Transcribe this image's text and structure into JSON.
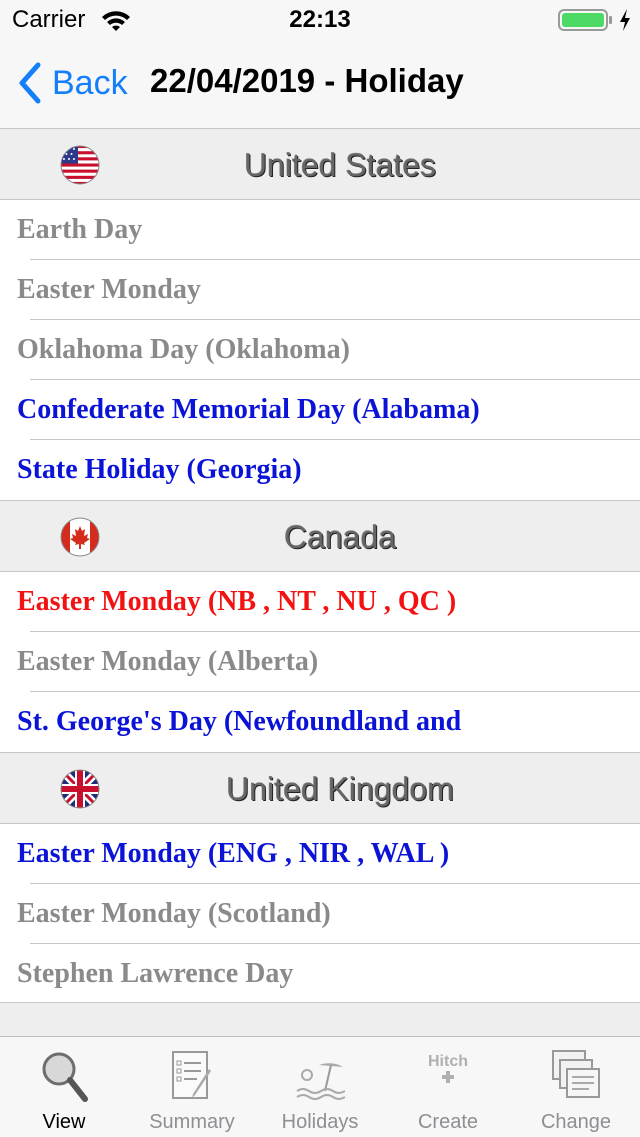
{
  "status": {
    "carrier": "Carrier",
    "time": "22:13"
  },
  "nav": {
    "back_label": "Back",
    "title": "22/04/2019 - Holiday"
  },
  "colors": {
    "gray": "#8a8a8a",
    "blue": "#0b14d6",
    "red": "#f21212",
    "ios_blue": "#147efb"
  },
  "sections": [
    {
      "title": "United States",
      "flag": "us-flag-icon",
      "rows": [
        {
          "text": "Earth Day",
          "color": "gray"
        },
        {
          "text": "Easter Monday",
          "color": "gray"
        },
        {
          "text": "Oklahoma Day (Oklahoma)",
          "color": "gray"
        },
        {
          "text": "Confederate Memorial Day (Alabama)",
          "color": "blue"
        },
        {
          "text": "State Holiday (Georgia)",
          "color": "blue"
        }
      ]
    },
    {
      "title": "Canada",
      "flag": "canada-flag-icon",
      "rows": [
        {
          "text": "Easter Monday (NB , NT , NU , QC )",
          "color": "red"
        },
        {
          "text": "Easter Monday (Alberta)",
          "color": "gray"
        },
        {
          "text": "St. George's Day (Newfoundland and",
          "color": "blue"
        }
      ]
    },
    {
      "title": "United Kingdom",
      "flag": "uk-flag-icon",
      "rows": [
        {
          "text": "Easter Monday (ENG , NIR , WAL )",
          "color": "blue"
        },
        {
          "text": "Easter Monday (Scotland)",
          "color": "gray"
        },
        {
          "text": "Stephen Lawrence Day",
          "color": "gray"
        }
      ]
    }
  ],
  "tabs": [
    {
      "label": "View",
      "icon": "magnifier-icon",
      "active": true
    },
    {
      "label": "Summary",
      "icon": "checklist-icon",
      "active": false
    },
    {
      "label": "Holidays",
      "icon": "beach-umbrella-icon",
      "active": false
    },
    {
      "label": "Create",
      "icon": "hitch-plus-icon",
      "icon_text": "Hitch",
      "active": false
    },
    {
      "label": "Change",
      "icon": "stacked-pages-icon",
      "active": false
    }
  ]
}
